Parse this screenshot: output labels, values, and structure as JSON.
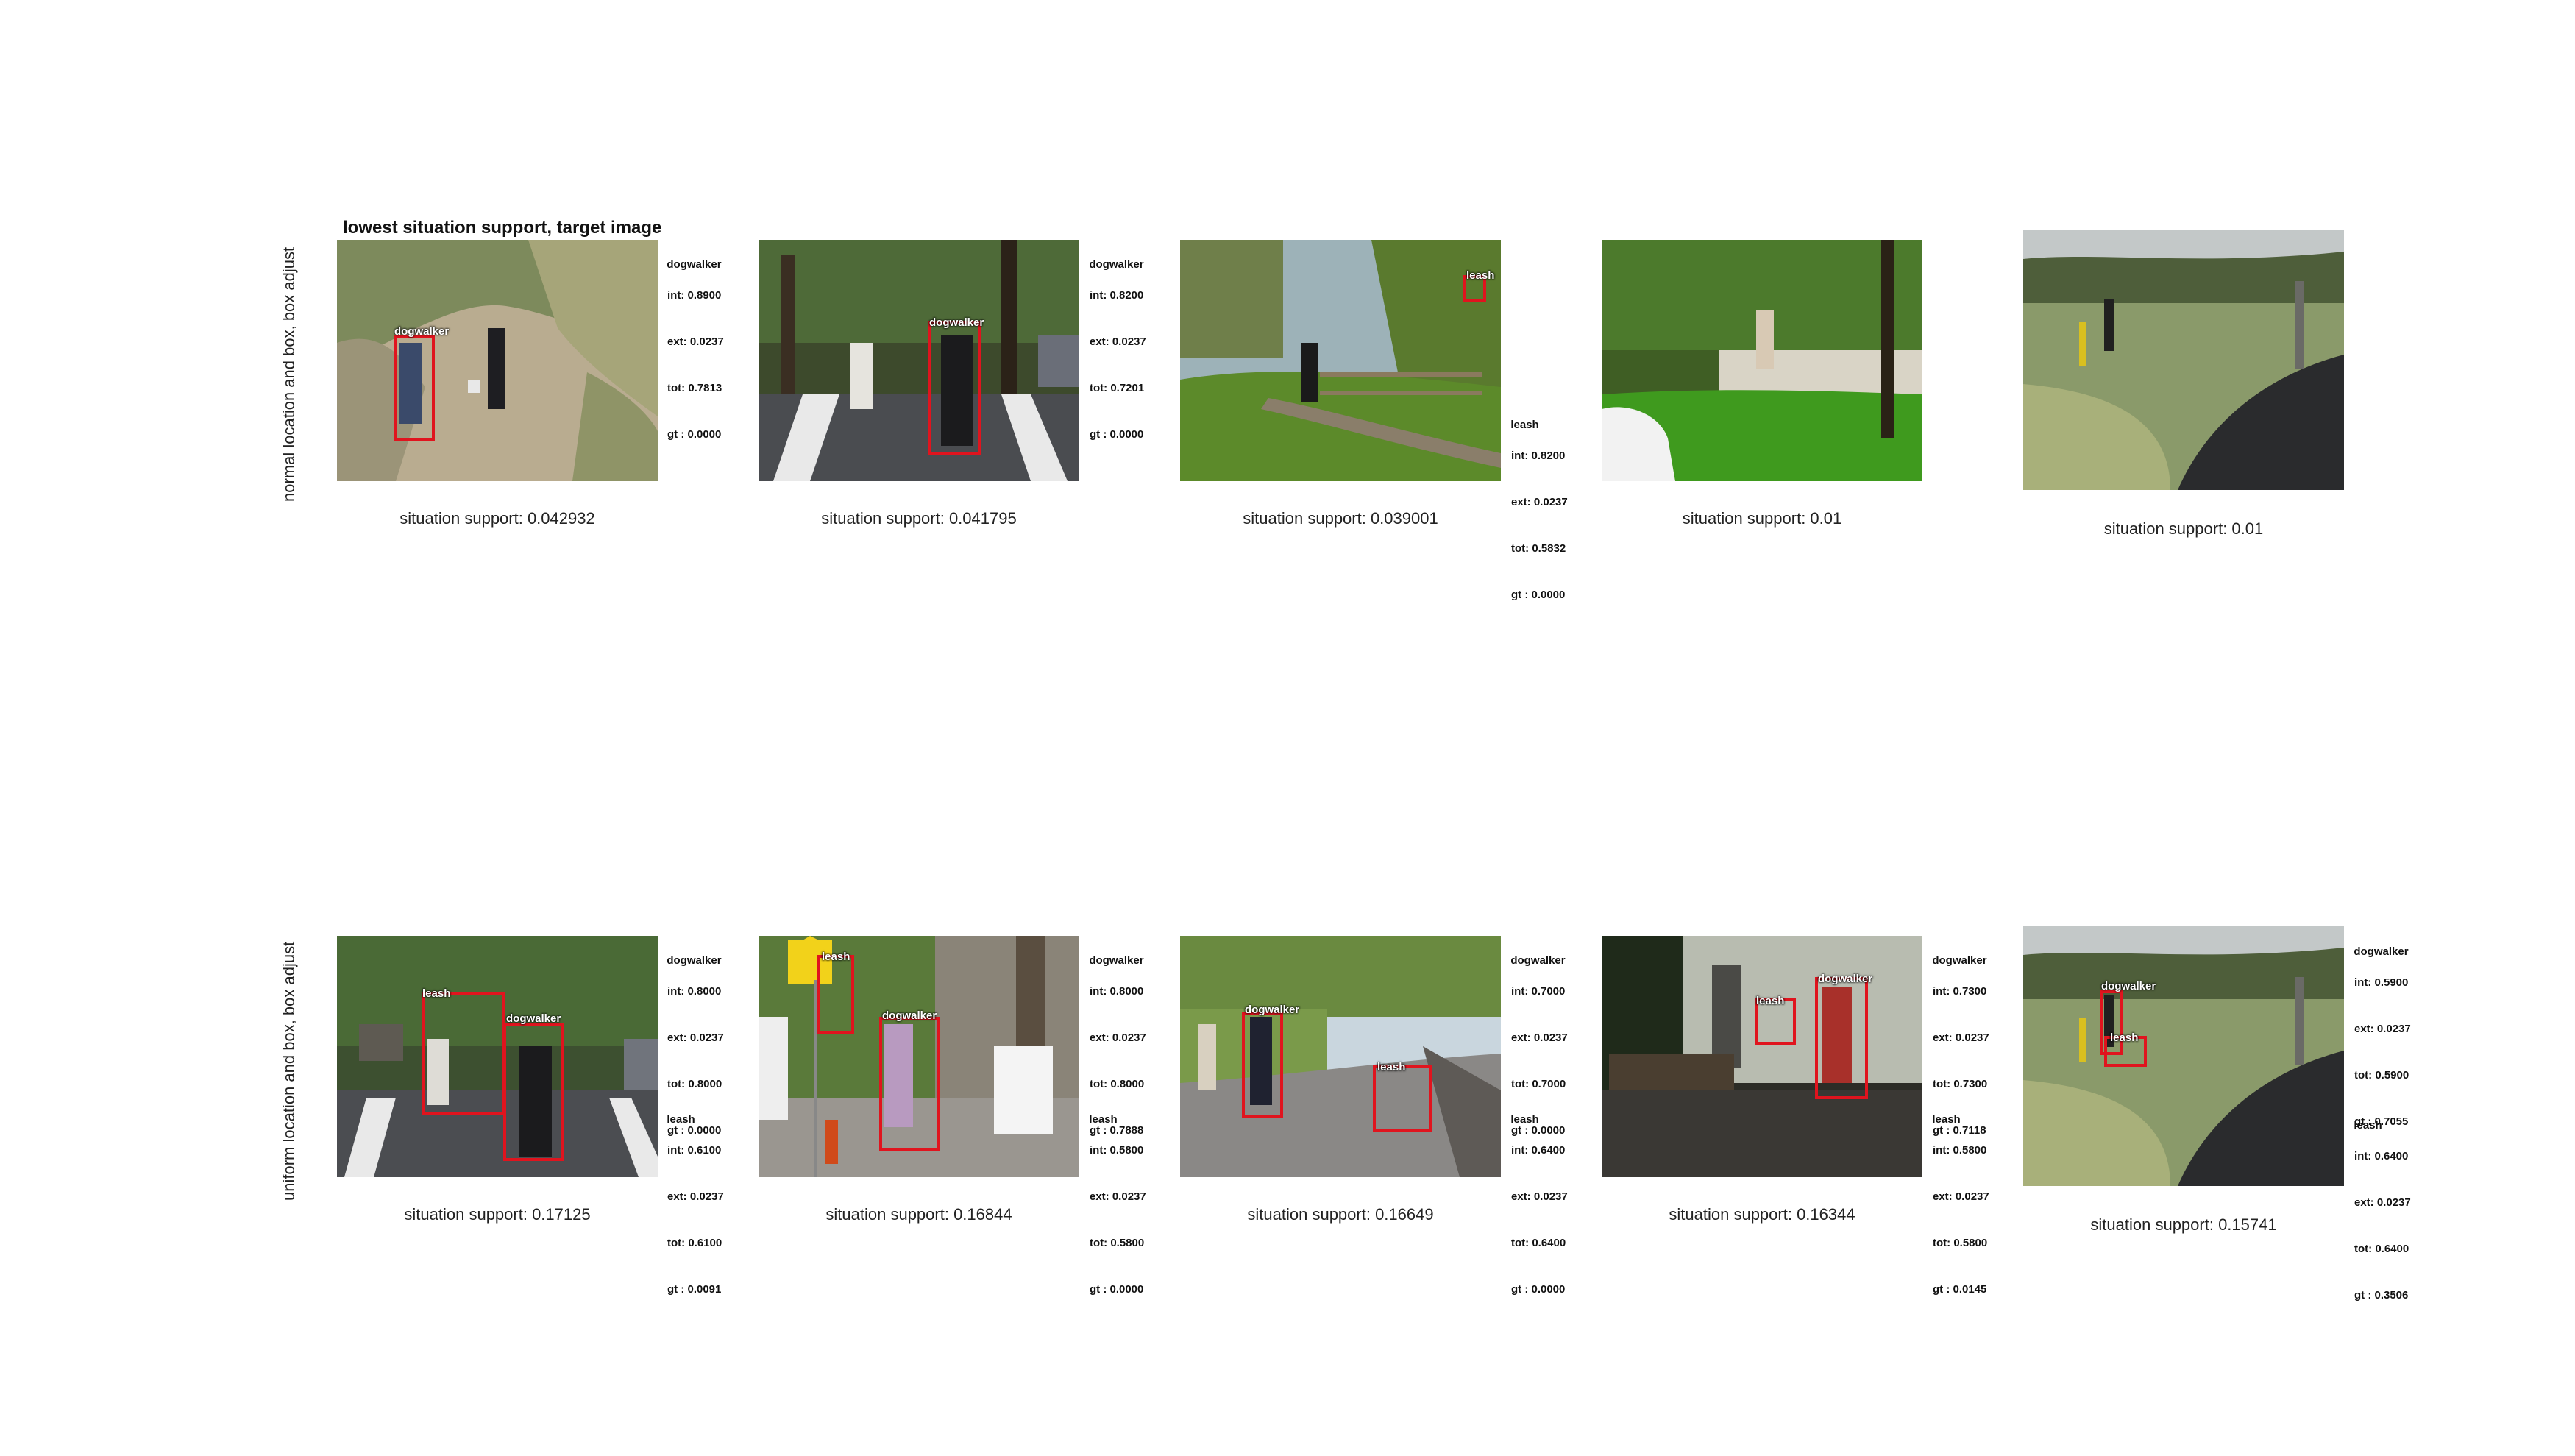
{
  "figure": {
    "title": "lowest situation support, target image",
    "row_labels": [
      "normal location and box, box adjust",
      "uniform location and box, box adjust"
    ]
  },
  "panels": [
    {
      "caption": "situation support: 0.042932",
      "boxes": [
        {
          "label": "dogwalker"
        }
      ],
      "stats": [
        {
          "role": "dogwalker",
          "int": "int: 0.8900",
          "ext": "ext: 0.0237",
          "tot": "tot: 0.7813",
          "gt": "gt : 0.0000"
        }
      ]
    },
    {
      "caption": "situation support: 0.041795",
      "boxes": [
        {
          "label": "dogwalker"
        }
      ],
      "stats": [
        {
          "role": "dogwalker",
          "int": "int: 0.8200",
          "ext": "ext: 0.0237",
          "tot": "tot: 0.7201",
          "gt": "gt : 0.0000"
        }
      ]
    },
    {
      "caption": "situation support: 0.039001",
      "boxes": [
        {
          "label": "leash"
        }
      ],
      "stats": [
        {
          "role": "leash",
          "int": "int: 0.8200",
          "ext": "ext: 0.0237",
          "tot": "tot: 0.5832",
          "gt": "gt : 0.0000"
        }
      ]
    },
    {
      "caption": "situation support: 0.01",
      "boxes": [],
      "stats": []
    },
    {
      "caption": "situation support: 0.01",
      "boxes": [],
      "stats": []
    },
    {
      "caption": "situation support: 0.17125",
      "boxes": [
        {
          "label": "leash"
        },
        {
          "label": "dogwalker"
        }
      ],
      "stats": [
        {
          "role": "dogwalker",
          "int": "int: 0.8000",
          "ext": "ext: 0.0237",
          "tot": "tot: 0.8000",
          "gt": "gt : 0.0000"
        },
        {
          "role": "leash",
          "int": "int: 0.6100",
          "ext": "ext: 0.0237",
          "tot": "tot: 0.6100",
          "gt": "gt : 0.0091"
        }
      ]
    },
    {
      "caption": "situation support: 0.16844",
      "boxes": [
        {
          "label": "leash"
        },
        {
          "label": "dogwalker"
        }
      ],
      "stats": [
        {
          "role": "dogwalker",
          "int": "int: 0.8000",
          "ext": "ext: 0.0237",
          "tot": "tot: 0.8000",
          "gt": "gt : 0.7888"
        },
        {
          "role": "leash",
          "int": "int: 0.5800",
          "ext": "ext: 0.0237",
          "tot": "tot: 0.5800",
          "gt": "gt : 0.0000"
        }
      ]
    },
    {
      "caption": "situation support: 0.16649",
      "boxes": [
        {
          "label": "dogwalker"
        },
        {
          "label": "leash"
        }
      ],
      "stats": [
        {
          "role": "dogwalker",
          "int": "int: 0.7000",
          "ext": "ext: 0.0237",
          "tot": "tot: 0.7000",
          "gt": "gt : 0.0000"
        },
        {
          "role": "leash",
          "int": "int: 0.6400",
          "ext": "ext: 0.0237",
          "tot": "tot: 0.6400",
          "gt": "gt : 0.0000"
        }
      ]
    },
    {
      "caption": "situation support: 0.16344",
      "boxes": [
        {
          "label": "leash"
        },
        {
          "label": "dogwalker"
        }
      ],
      "stats": [
        {
          "role": "dogwalker",
          "int": "int: 0.7300",
          "ext": "ext: 0.0237",
          "tot": "tot: 0.7300",
          "gt": "gt : 0.7118"
        },
        {
          "role": "leash",
          "int": "int: 0.5800",
          "ext": "ext: 0.0237",
          "tot": "tot: 0.5800",
          "gt": "gt : 0.0145"
        }
      ]
    },
    {
      "caption": "situation support: 0.15741",
      "boxes": [
        {
          "label": "dogwalker"
        },
        {
          "label": "leash"
        }
      ],
      "stats": [
        {
          "role": "dogwalker",
          "int": "int: 0.5900",
          "ext": "ext: 0.0237",
          "tot": "tot: 0.5900",
          "gt": "gt : 0.7055"
        },
        {
          "role": "leash",
          "int": "int: 0.6400",
          "ext": "ext: 0.0237",
          "tot": "tot: 0.6400",
          "gt": "gt : 0.3506"
        }
      ]
    }
  ]
}
